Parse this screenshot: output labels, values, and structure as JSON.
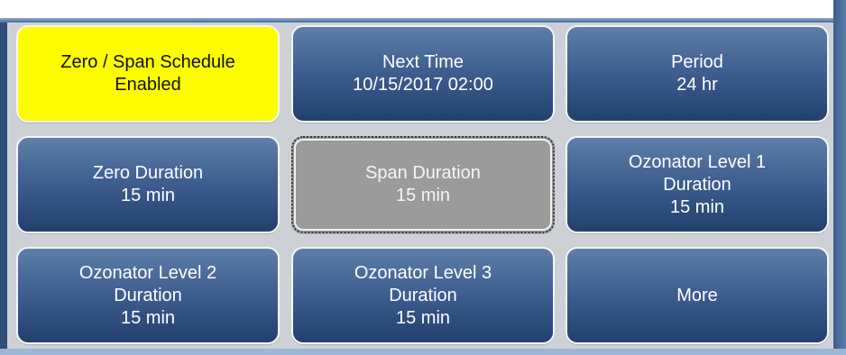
{
  "schedule": {
    "buttons": [
      {
        "lines": [
          "Zero / Span Schedule",
          "Enabled"
        ]
      },
      {
        "lines": [
          "Next Time",
          "10/15/2017 02:00"
        ]
      },
      {
        "lines": [
          "Period",
          "24 hr"
        ]
      },
      {
        "lines": [
          "Zero Duration",
          "15 min"
        ]
      },
      {
        "lines": [
          "Span Duration",
          "15 min"
        ]
      },
      {
        "lines": [
          "Ozonator Level 1",
          "Duration",
          "15 min"
        ]
      },
      {
        "lines": [
          "Ozonator Level 2",
          "Duration",
          "15 min"
        ]
      },
      {
        "lines": [
          "Ozonator Level 3",
          "Duration",
          "15 min"
        ]
      },
      {
        "lines": [
          "More"
        ]
      }
    ]
  },
  "colors": {
    "active_tile": "#fdfd00",
    "disabled_tile": "#9b9b9b",
    "tile_blue_top": "#5f7ea8",
    "tile_blue_bottom": "#22406e",
    "panel_bg": "#cdd1d6"
  }
}
